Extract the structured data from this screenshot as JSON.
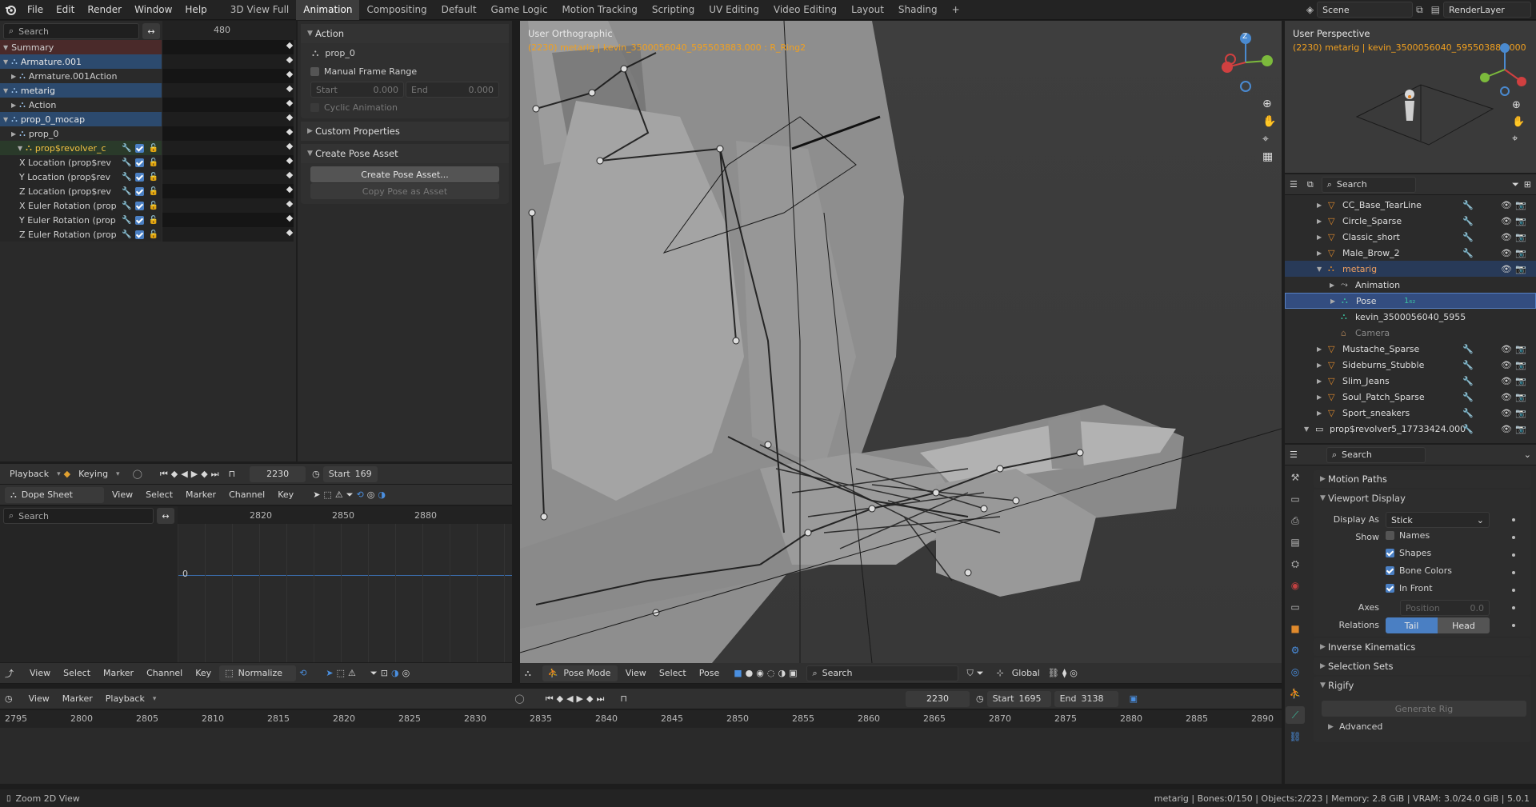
{
  "topbar": {
    "menus": [
      "File",
      "Edit",
      "Render",
      "Window",
      "Help"
    ],
    "workspaces": [
      "3D View Full",
      "Animation",
      "Compositing",
      "Default",
      "Game Logic",
      "Motion Tracking",
      "Scripting",
      "UV Editing",
      "Video Editing",
      "Layout",
      "Shading"
    ],
    "active_workspace": "Animation",
    "add_tab": "+",
    "scene": "Scene",
    "render_layer": "RenderLayer"
  },
  "dopesheet_top": {
    "search_placeholder": "Search",
    "frame_tick": "480",
    "channels": [
      {
        "label": "Summary",
        "kind": "summary"
      },
      {
        "label": "Armature.001",
        "kind": "object"
      },
      {
        "label": "Armature.001Action",
        "kind": "action"
      },
      {
        "label": "metarig",
        "kind": "object"
      },
      {
        "label": "Action",
        "kind": "action"
      },
      {
        "label": "prop_0_mocap",
        "kind": "object"
      },
      {
        "label": "prop_0",
        "kind": "action"
      },
      {
        "label": "prop$revolver_c",
        "kind": "group"
      },
      {
        "label": "X Location (prop$rev",
        "kind": "fcurve"
      },
      {
        "label": "Y Location (prop$rev",
        "kind": "fcurve"
      },
      {
        "label": "Z Location (prop$rev",
        "kind": "fcurve"
      },
      {
        "label": "X Euler Rotation (prop",
        "kind": "fcurve"
      },
      {
        "label": "Y Euler Rotation (prop",
        "kind": "fcurve"
      },
      {
        "label": "Z Euler Rotation (prop",
        "kind": "fcurve"
      }
    ]
  },
  "action_panel": {
    "action_title": "Action",
    "action_name": "prop_0",
    "manual_frame_range": "Manual Frame Range",
    "start_label": "Start",
    "start_value": "0.000",
    "end_label": "End",
    "end_value": "0.000",
    "cyclic": "Cyclic Animation",
    "custom_properties": "Custom Properties",
    "create_pose_asset_title": "Create Pose Asset",
    "create_pose_asset_btn": "Create Pose Asset...",
    "copy_pose_btn": "Copy Pose as Asset"
  },
  "playback_bar": {
    "playback": "Playback",
    "keying": "Keying",
    "current_frame": "2230",
    "start": "Start",
    "start_value": "169"
  },
  "dopesheet_header": {
    "mode": "Dope Sheet",
    "menus": [
      "View",
      "Select",
      "Marker",
      "Channel",
      "Key"
    ]
  },
  "graph_lower": {
    "search_placeholder": "Search",
    "ticks": [
      "2820",
      "2850",
      "2880"
    ],
    "zero_label": "0"
  },
  "graph_header": {
    "menus": [
      "View",
      "Select",
      "Marker",
      "Channel",
      "Key"
    ],
    "normalize": "Normalize"
  },
  "viewport": {
    "view_name": "User Orthographic",
    "info": "(2230) metarig | kevin_3500056040_595503883.000 : R_Ring2",
    "gizmo_z": "Z",
    "gizmo_y": "Y",
    "gizmo_x": "X",
    "header": {
      "mode": "Pose Mode",
      "menus": [
        "View",
        "Select",
        "Pose"
      ],
      "search_placeholder": "Search",
      "orientation": "Global"
    }
  },
  "mini_viewport": {
    "view_name": "User Perspective",
    "info": "(2230) metarig | kevin_3500056040_595503883.000"
  },
  "outliner": {
    "search_placeholder": "Search",
    "rows": [
      {
        "label": "CC_Base_TearLine",
        "indent": 0,
        "kind": "mesh"
      },
      {
        "label": "Circle_Sparse",
        "indent": 0,
        "kind": "mesh"
      },
      {
        "label": "Classic_short",
        "indent": 0,
        "kind": "mesh"
      },
      {
        "label": "Male_Brow_2",
        "indent": 0,
        "kind": "mesh"
      },
      {
        "label": "metarig",
        "indent": 0,
        "kind": "armature"
      },
      {
        "label": "Animation",
        "indent": 1,
        "kind": "anim"
      },
      {
        "label": "Pose",
        "indent": 1,
        "kind": "pose"
      },
      {
        "label": "kevin_3500056040_5955",
        "indent": 1,
        "kind": "data"
      },
      {
        "label": "Camera",
        "indent": 1,
        "kind": "camera"
      },
      {
        "label": "Mustache_Sparse",
        "indent": 0,
        "kind": "mesh"
      },
      {
        "label": "Sideburns_Stubble",
        "indent": 0,
        "kind": "mesh"
      },
      {
        "label": "Slim_Jeans",
        "indent": 0,
        "kind": "mesh"
      },
      {
        "label": "Soul_Patch_Sparse",
        "indent": 0,
        "kind": "mesh"
      },
      {
        "label": "Sport_sneakers",
        "indent": 0,
        "kind": "mesh"
      },
      {
        "label": "prop$revolver5_17733424.000",
        "indent": -1,
        "kind": "collection"
      }
    ],
    "pose_badge": "1₆₂"
  },
  "properties": {
    "search_placeholder": "Search",
    "motion_paths": "Motion Paths",
    "viewport_display": "Viewport Display",
    "display_as_label": "Display As",
    "display_as_value": "Stick",
    "show_label": "Show",
    "names": "Names",
    "shapes": "Shapes",
    "bone_colors": "Bone Colors",
    "in_front": "In Front",
    "axes_label": "Axes",
    "position_label": "Position",
    "position_value": "0.0",
    "relations_label": "Relations",
    "tail": "Tail",
    "head": "Head",
    "inverse_kinematics": "Inverse Kinematics",
    "selection_sets": "Selection Sets",
    "rigify": "Rigify",
    "generate_rig": "Generate Rig",
    "advanced": "Advanced"
  },
  "timeline": {
    "menus": [
      "View",
      "Marker",
      "Playback"
    ],
    "current_frame": "2230",
    "start_label": "Start",
    "start_value": "1695",
    "end_label": "End",
    "end_value": "3138",
    "ticks": [
      "2795",
      "2800",
      "2805",
      "2810",
      "2815",
      "2820",
      "2825",
      "2830",
      "2835",
      "2840",
      "2845",
      "2850",
      "2855",
      "2860",
      "2865",
      "2870",
      "2875",
      "2880",
      "2885",
      "2890"
    ]
  },
  "statusbar": {
    "left": "Zoom 2D View",
    "right": "metarig | Bones:0/150 | Objects:2/223 | Memory: 2.8 GiB | VRAM: 3.0/24.0 GiB | 5.0.1"
  }
}
